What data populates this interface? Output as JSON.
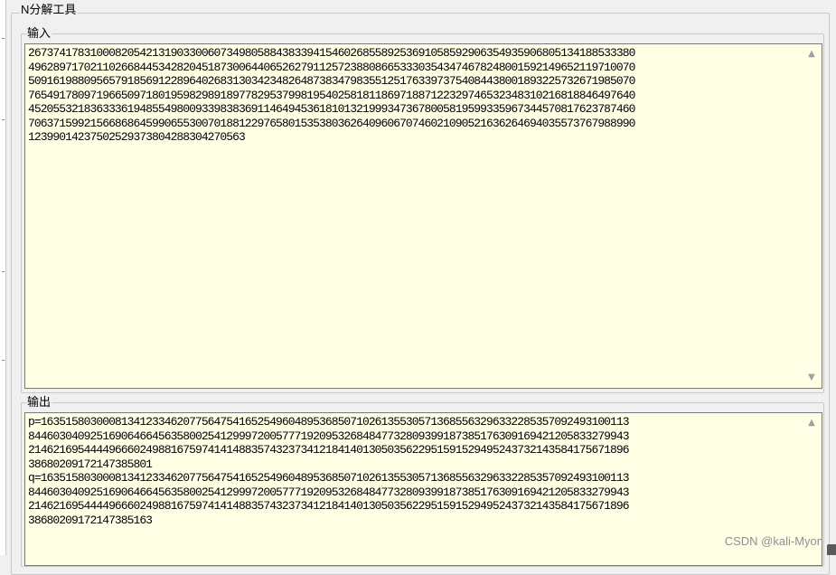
{
  "window": {
    "group_title": "N分解工具"
  },
  "input": {
    "label": "输入",
    "lines": [
      "26737417831000820542131903300607349805884383394154602685589253691058592906354935906805134188533380",
      "49628971702110266844534282045187300644065262791125723880866533303543474678248001592149652119710070",
      "50916198809565791856912289640268313034234826487383479835512517633973754084438001893225732671985070",
      "76549178097196650971801959829891897782953799819540258181186971887122329746532348310216818846497640",
      "45205532183633361948554980093398383691146494536181013219993473678005819599335967344570817623787460",
      "70637159921566868645990655300701881229765801535380362640960670746021090521636264694035573767988990",
      "123990142375025293738042883042705 63"
    ]
  },
  "output": {
    "label": "输出",
    "lines": [
      "p=1635158030008134123346207756475416525496048953685071026135530571368556329633228535709249310011 3",
      "84460304092516906466456358002541299972005777192095326848477328093991873851763091694212058332799 43",
      "21462169544449666024988167597414148835743237341218414013050356229515915294952437321435841756718 96",
      "3868020917214738580 1",
      "q=1635158030008134123346207756475416525496048953685071026135530571368556329633228535709249310011 3",
      "84460304092516906466456358002541299972005777192095326848477328093991873851763091694212058332799 43",
      "21462169544449666024988167597414148835743237341218414013050356229515915294952437321435841756718 96",
      "3868020917214738516 3"
    ]
  },
  "scroll": {
    "up_icon": "▲",
    "down_icon": "▼"
  },
  "watermark": "CSDN @kali-Myon"
}
